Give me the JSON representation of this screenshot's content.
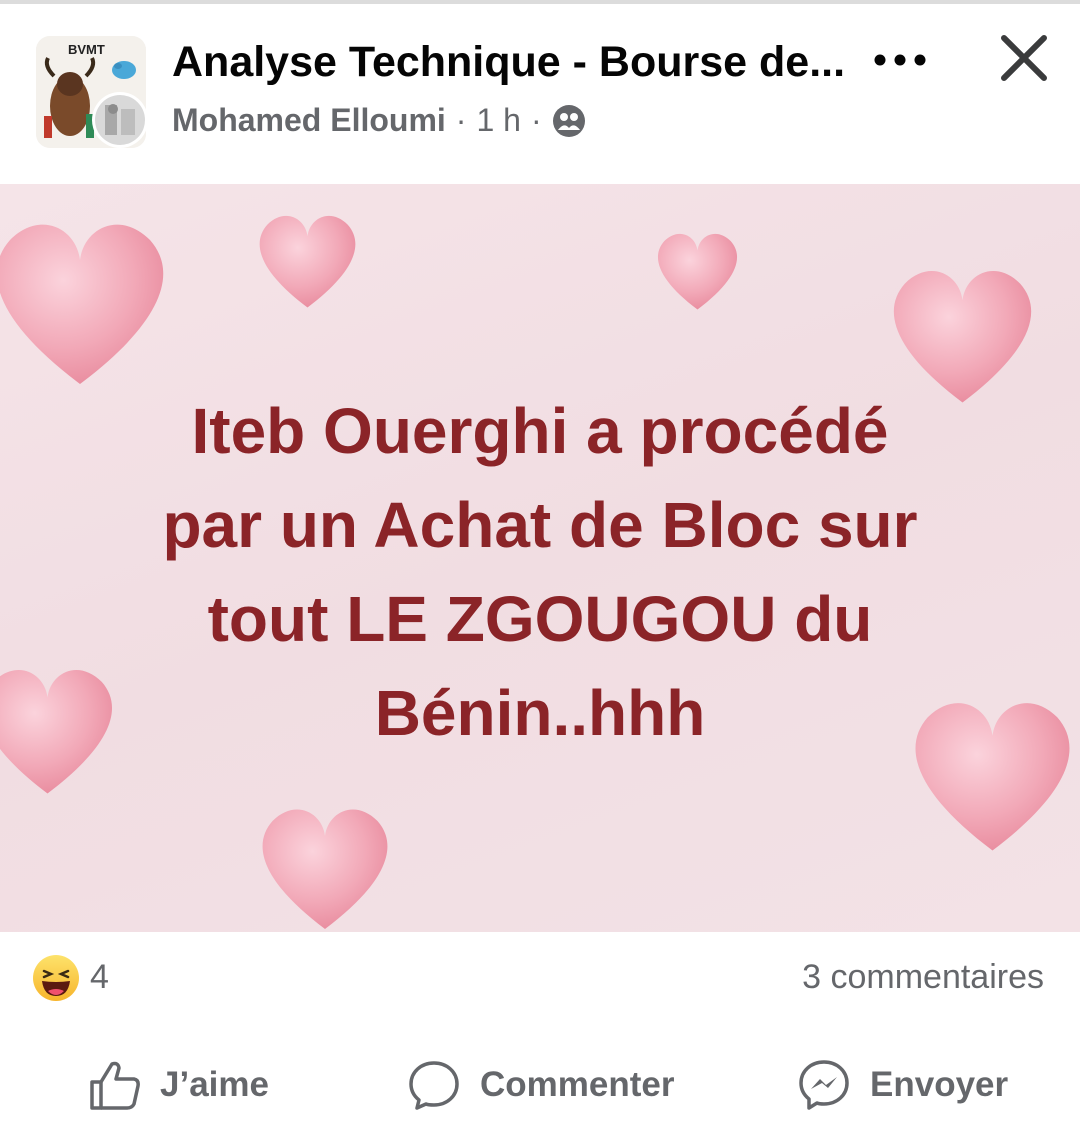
{
  "post": {
    "group_name": "Analyse Technique - Bourse de...",
    "author": "Mohamed Elloumi",
    "time": "1 h",
    "separator": "·",
    "audience_icon": "group-audience-icon",
    "group_avatar_text": "BVMT"
  },
  "image": {
    "lines": [
      "Iteb Ouerghi a procédé",
      "par un Achat de Bloc sur",
      "tout LE ZGOUGOU du",
      "Bénin..hhh"
    ],
    "text_color": "#8b2428"
  },
  "stats": {
    "reaction_icon": "haha-emoji-icon",
    "reaction_count": "4",
    "comments": "3 commentaires"
  },
  "actions": {
    "like": "J’aime",
    "comment": "Commenter",
    "send": "Envoyer"
  },
  "colors": {
    "secondary_text": "#65676b",
    "primary_text": "#050505"
  }
}
